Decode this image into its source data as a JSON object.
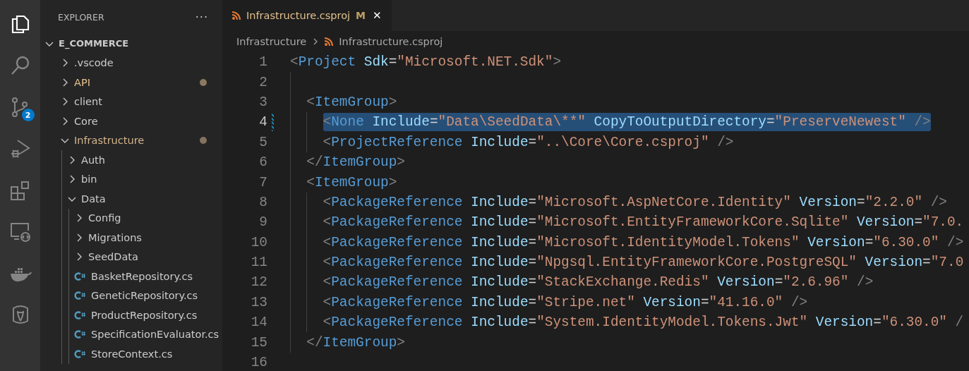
{
  "activity_bar": {
    "items": [
      {
        "kind": "files",
        "selected": true
      },
      {
        "kind": "search",
        "selected": false
      },
      {
        "kind": "source-control",
        "selected": false,
        "badge": "2"
      },
      {
        "kind": "run",
        "selected": false
      },
      {
        "kind": "extensions",
        "selected": false
      },
      {
        "kind": "remote",
        "selected": false
      },
      {
        "kind": "docker",
        "selected": false
      },
      {
        "kind": "database",
        "selected": false
      }
    ]
  },
  "sidebar": {
    "title": "EXPLORER",
    "more": "···",
    "root": {
      "name": "E_COMMERCE",
      "expanded": true,
      "children": [
        {
          "name": ".vscode",
          "kind": "folder",
          "expanded": false
        },
        {
          "name": "API",
          "kind": "folder",
          "expanded": false,
          "color": "#e2c08d"
        },
        {
          "name": "client",
          "kind": "folder",
          "expanded": false
        },
        {
          "name": "Core",
          "kind": "folder",
          "expanded": false
        },
        {
          "name": "Infrastructure",
          "kind": "folder",
          "expanded": true,
          "color": "#d4b58c",
          "children": [
            {
              "name": "Auth",
              "kind": "folder",
              "expanded": false
            },
            {
              "name": "bin",
              "kind": "folder",
              "expanded": false
            },
            {
              "name": "Data",
              "kind": "folder",
              "expanded": true,
              "children": [
                {
                  "name": "Config",
                  "kind": "folder",
                  "expanded": false
                },
                {
                  "name": "Migrations",
                  "kind": "folder",
                  "expanded": false
                },
                {
                  "name": "SeedData",
                  "kind": "folder",
                  "expanded": false
                },
                {
                  "name": "BasketRepository.cs",
                  "kind": "file"
                },
                {
                  "name": "GeneticRepository.cs",
                  "kind": "file"
                },
                {
                  "name": "ProductRepository.cs",
                  "kind": "file"
                },
                {
                  "name": "SpecificationEvaluator.cs",
                  "kind": "file"
                },
                {
                  "name": "StoreContext.cs",
                  "kind": "file"
                }
              ]
            }
          ]
        }
      ]
    }
  },
  "tabs": [
    {
      "label": "Infrastructure.csproj",
      "badge": "M",
      "close": "✕",
      "selected": true
    }
  ],
  "breadcrumbs": [
    "Infrastructure",
    "Infrastructure.csproj"
  ],
  "editor": {
    "lines": [
      {
        "number": "1",
        "selected": false,
        "modified": false,
        "tokens": [
          {
            "kind": "punct",
            "text": "<"
          },
          {
            "kind": "tag",
            "text": "Project"
          },
          {
            "kind": "attr",
            "text": " Sdk"
          },
          {
            "kind": "punct2",
            "text": "="
          },
          {
            "kind": "str",
            "text": "\"Microsoft.NET.Sdk\""
          },
          {
            "kind": "punct",
            "text": ">"
          }
        ],
        "children": [
          {
            "number": "2",
            "selected": false,
            "modified": false
          },
          {
            "number": "3",
            "selected": false,
            "modified": false,
            "tokens": [
              {
                "kind": "punct",
                "text": "<"
              },
              {
                "kind": "tag",
                "text": "ItemGroup"
              },
              {
                "kind": "punct",
                "text": ">"
              }
            ],
            "children": [
              {
                "number": "4",
                "selected": true,
                "modified": true,
                "tokens": [
                  {
                    "kind": "punct",
                    "text": "<"
                  },
                  {
                    "kind": "tag",
                    "text": "None"
                  },
                  {
                    "kind": "attr",
                    "text": " Include"
                  },
                  {
                    "kind": "punct2",
                    "text": "="
                  },
                  {
                    "kind": "str",
                    "text": "\"Data\\SeedData\\**\""
                  },
                  {
                    "kind": "attr",
                    "text": " CopyToOutputDirectory"
                  },
                  {
                    "kind": "punct2",
                    "text": "="
                  },
                  {
                    "kind": "str",
                    "text": "\"PreserveNewest\""
                  },
                  {
                    "kind": "punct",
                    "text": " />"
                  }
                ]
              },
              {
                "number": "5",
                "selected": false,
                "modified": false,
                "tokens": [
                  {
                    "kind": "punct",
                    "text": "<"
                  },
                  {
                    "kind": "tag",
                    "text": "ProjectReference"
                  },
                  {
                    "kind": "attr",
                    "text": " Include"
                  },
                  {
                    "kind": "punct2",
                    "text": "="
                  },
                  {
                    "kind": "str",
                    "text": "\"..\\Core\\Core.csproj\""
                  },
                  {
                    "kind": "punct",
                    "text": " />"
                  }
                ]
              }
            ]
          },
          {
            "number": "6",
            "selected": false,
            "modified": false,
            "tokens": [
              {
                "kind": "punct",
                "text": "</"
              },
              {
                "kind": "tag",
                "text": "ItemGroup"
              },
              {
                "kind": "punct",
                "text": ">"
              }
            ]
          },
          {
            "number": "7",
            "selected": false,
            "modified": false,
            "tokens": [
              {
                "kind": "punct",
                "text": "<"
              },
              {
                "kind": "tag",
                "text": "ItemGroup"
              },
              {
                "kind": "punct",
                "text": ">"
              }
            ],
            "children": [
              {
                "number": "8",
                "selected": false,
                "modified": false,
                "tokens": [
                  {
                    "kind": "punct",
                    "text": "<"
                  },
                  {
                    "kind": "tag",
                    "text": "PackageReference"
                  },
                  {
                    "kind": "attr",
                    "text": " Include"
                  },
                  {
                    "kind": "punct2",
                    "text": "="
                  },
                  {
                    "kind": "str",
                    "text": "\"Microsoft.AspNetCore.Identity\""
                  },
                  {
                    "kind": "attr",
                    "text": " Version"
                  },
                  {
                    "kind": "punct2",
                    "text": "="
                  },
                  {
                    "kind": "str",
                    "text": "\"2.2.0\""
                  },
                  {
                    "kind": "punct",
                    "text": " />"
                  }
                ]
              },
              {
                "number": "9",
                "selected": false,
                "modified": false,
                "tokens": [
                  {
                    "kind": "punct",
                    "text": "<"
                  },
                  {
                    "kind": "tag",
                    "text": "PackageReference"
                  },
                  {
                    "kind": "attr",
                    "text": " Include"
                  },
                  {
                    "kind": "punct2",
                    "text": "="
                  },
                  {
                    "kind": "str",
                    "text": "\"Microsoft.EntityFrameworkCore.Sqlite\""
                  },
                  {
                    "kind": "attr",
                    "text": " Version"
                  },
                  {
                    "kind": "punct2",
                    "text": "="
                  },
                  {
                    "kind": "str",
                    "text": "\"7.0."
                  }
                ]
              },
              {
                "number": "10",
                "selected": false,
                "modified": false,
                "tokens": [
                  {
                    "kind": "punct",
                    "text": "<"
                  },
                  {
                    "kind": "tag",
                    "text": "PackageReference"
                  },
                  {
                    "kind": "attr",
                    "text": " Include"
                  },
                  {
                    "kind": "punct2",
                    "text": "="
                  },
                  {
                    "kind": "str",
                    "text": "\"Microsoft.IdentityModel.Tokens\""
                  },
                  {
                    "kind": "attr",
                    "text": " Version"
                  },
                  {
                    "kind": "punct2",
                    "text": "="
                  },
                  {
                    "kind": "str",
                    "text": "\"6.30.0\""
                  },
                  {
                    "kind": "punct",
                    "text": " />"
                  }
                ]
              },
              {
                "number": "11",
                "selected": false,
                "modified": false,
                "tokens": [
                  {
                    "kind": "punct",
                    "text": "<"
                  },
                  {
                    "kind": "tag",
                    "text": "PackageReference"
                  },
                  {
                    "kind": "attr",
                    "text": " Include"
                  },
                  {
                    "kind": "punct2",
                    "text": "="
                  },
                  {
                    "kind": "str",
                    "text": "\"Npgsql.EntityFrameworkCore.PostgreSQL\""
                  },
                  {
                    "kind": "attr",
                    "text": " Version"
                  },
                  {
                    "kind": "punct2",
                    "text": "="
                  },
                  {
                    "kind": "str",
                    "text": "\"7.0"
                  }
                ]
              },
              {
                "number": "12",
                "selected": false,
                "modified": false,
                "tokens": [
                  {
                    "kind": "punct",
                    "text": "<"
                  },
                  {
                    "kind": "tag",
                    "text": "PackageReference"
                  },
                  {
                    "kind": "attr",
                    "text": " Include"
                  },
                  {
                    "kind": "punct2",
                    "text": "="
                  },
                  {
                    "kind": "str",
                    "text": "\"StackExchange.Redis\""
                  },
                  {
                    "kind": "attr",
                    "text": " Version"
                  },
                  {
                    "kind": "punct2",
                    "text": "="
                  },
                  {
                    "kind": "str",
                    "text": "\"2.6.96\""
                  },
                  {
                    "kind": "punct",
                    "text": " />"
                  }
                ]
              },
              {
                "number": "13",
                "selected": false,
                "modified": false,
                "tokens": [
                  {
                    "kind": "punct",
                    "text": "<"
                  },
                  {
                    "kind": "tag",
                    "text": "PackageReference"
                  },
                  {
                    "kind": "attr",
                    "text": " Include"
                  },
                  {
                    "kind": "punct2",
                    "text": "="
                  },
                  {
                    "kind": "str",
                    "text": "\"Stripe.net\""
                  },
                  {
                    "kind": "attr",
                    "text": " Version"
                  },
                  {
                    "kind": "punct2",
                    "text": "="
                  },
                  {
                    "kind": "str",
                    "text": "\"41.16.0\""
                  },
                  {
                    "kind": "punct",
                    "text": " />"
                  }
                ]
              },
              {
                "number": "14",
                "selected": false,
                "modified": false,
                "tokens": [
                  {
                    "kind": "punct",
                    "text": "<"
                  },
                  {
                    "kind": "tag",
                    "text": "PackageReference"
                  },
                  {
                    "kind": "attr",
                    "text": " Include"
                  },
                  {
                    "kind": "punct2",
                    "text": "="
                  },
                  {
                    "kind": "str",
                    "text": "\"System.IdentityModel.Tokens.Jwt\""
                  },
                  {
                    "kind": "attr",
                    "text": " Version"
                  },
                  {
                    "kind": "punct2",
                    "text": "="
                  },
                  {
                    "kind": "str",
                    "text": "\"6.30.0\""
                  },
                  {
                    "kind": "punct",
                    "text": " /"
                  }
                ]
              }
            ]
          },
          {
            "number": "15",
            "selected": false,
            "modified": false,
            "tokens": [
              {
                "kind": "punct",
                "text": "</"
              },
              {
                "kind": "tag",
                "text": "ItemGroup"
              },
              {
                "kind": "punct",
                "text": ">"
              }
            ]
          }
        ]
      },
      {
        "number": "16",
        "selected": false,
        "modified": false
      }
    ]
  }
}
